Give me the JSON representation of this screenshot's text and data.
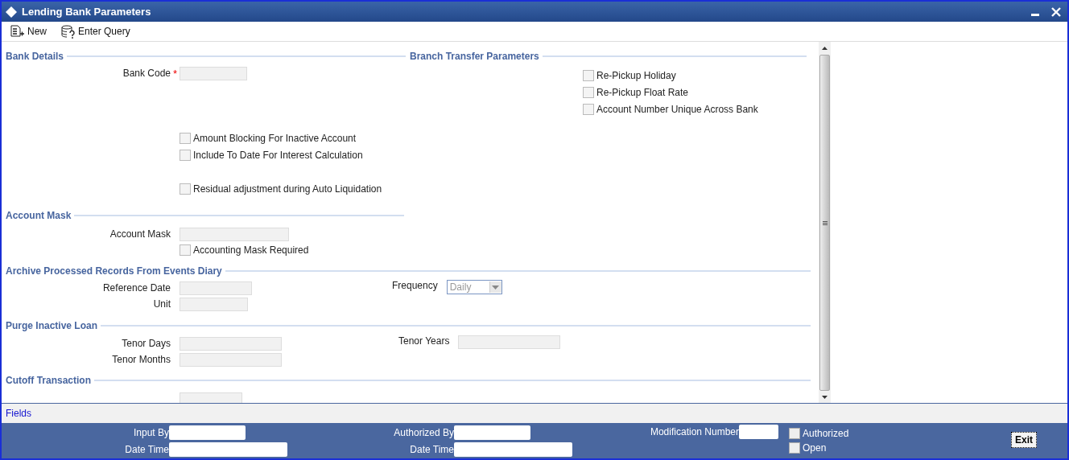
{
  "window": {
    "title": "Lending Bank Parameters"
  },
  "toolbar": [
    {
      "label": "New",
      "kind": "new"
    },
    {
      "label": "Enter Query",
      "kind": "query"
    }
  ],
  "bank_details": {
    "heading": "Bank Details",
    "bank_code": {
      "label": "Bank Code",
      "required_mark": "*"
    },
    "options": [
      {
        "label": "Amount Blocking For Inactive Account",
        "checked": false
      },
      {
        "label": "Include To Date For Interest Calculation",
        "checked": false
      },
      {
        "label": "Residual adjustment during Auto Liquidation",
        "checked": false
      }
    ]
  },
  "branch_transfer": {
    "heading": "Branch Transfer Parameters",
    "options": [
      {
        "label": "Re-Pickup Holiday",
        "checked": false
      },
      {
        "label": "Re-Pickup Float Rate",
        "checked": false
      },
      {
        "label": "Account Number Unique Across Bank",
        "checked": false
      }
    ]
  },
  "account_mask": {
    "heading": "Account Mask",
    "field": {
      "label": "Account Mask"
    },
    "option": {
      "label": "Accounting Mask Required",
      "checked": false
    }
  },
  "archive": {
    "heading": "Archive Processed Records From Events Diary",
    "reference_date": {
      "label": "Reference Date"
    },
    "unit": {
      "label": "Unit"
    },
    "frequency": {
      "label": "Frequency",
      "value": "Daily"
    }
  },
  "purge": {
    "heading": "Purge Inactive Loan",
    "tenor_days": {
      "label": "Tenor Days"
    },
    "tenor_months": {
      "label": "Tenor Months"
    },
    "tenor_years": {
      "label": "Tenor Years"
    }
  },
  "cutoff": {
    "heading": "Cutoff Transaction"
  },
  "fields_link": "Fields",
  "audit": {
    "input_by": "Input By",
    "date_time_1": "Date Time",
    "authorized_by": "Authorized By",
    "date_time_2": "Date Time",
    "modification_number": "Modification Number",
    "checks": [
      {
        "label": "Authorized",
        "checked": false
      },
      {
        "label": "Open",
        "checked": false
      }
    ],
    "exit": "Exit"
  }
}
